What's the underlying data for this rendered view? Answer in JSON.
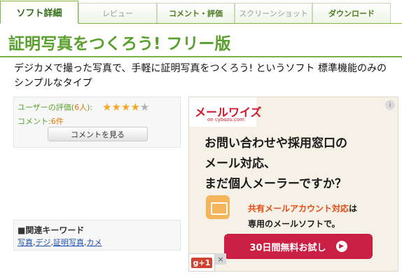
{
  "tabs": [
    {
      "label": "ソフト詳細"
    },
    {
      "label": "レビュー"
    },
    {
      "label": "コメント・評価"
    },
    {
      "label": "スクリーンショット"
    },
    {
      "label": "ダウンロード"
    }
  ],
  "title": "証明写真をつくろう! フリー版",
  "description": "デジカメで撮った写真で、手軽に証明写真をつくろう! というソフト 標準機能のみのシンプルなタイプ",
  "rating": {
    "label_prefix": "ユーザーの評価(",
    "count": "6人",
    "label_suffix": "):",
    "stars_value": 4.5,
    "comment_prefix": "コメント:",
    "comment_count": "6件",
    "button_label": "コメントを見る"
  },
  "keywords": {
    "title": "■関連キーワード",
    "items": [
      "写真",
      "デジ",
      "証明写真",
      "カメ"
    ],
    "separator": ","
  },
  "ad": {
    "logo": "メールワイズ",
    "logo_sub": "on cybozu.com",
    "headline_lines": [
      "お問い合わせや採用窓口の",
      "メール対応、",
      "まだ個人メーラーですか？"
    ],
    "sub_highlight": "共有メールアカウント対応",
    "sub_after": "は",
    "sub_line2": "専用のメールソフトで。",
    "cta": "30日間無料お試し",
    "info": "i",
    "close": "×"
  },
  "gplus": "g+1",
  "colors": {
    "accent": "#7cb342",
    "title": "#5aa02c",
    "link": "#1a4fb0",
    "cta": "#cc1f44"
  }
}
